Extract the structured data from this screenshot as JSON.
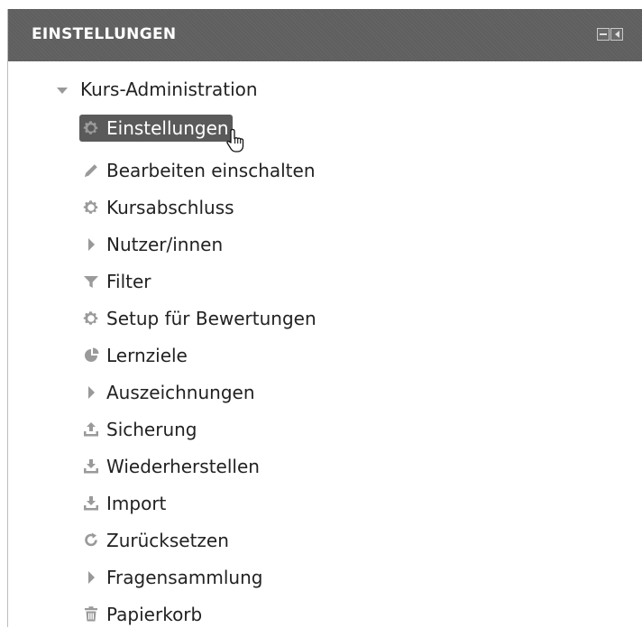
{
  "block": {
    "title": "EINSTELLUNGEN",
    "controls": {
      "collapse_icon": "collapse-icon",
      "dock_icon": "dock-icon"
    }
  },
  "tree": {
    "root_label": "Kurs-Administration",
    "items": [
      {
        "label": "Einstellungen",
        "icon": "gear-icon",
        "active": true
      },
      {
        "label": "Bearbeiten einschalten",
        "icon": "pencil-icon"
      },
      {
        "label": "Kursabschluss",
        "icon": "gear-icon"
      },
      {
        "label": "Nutzer/innen",
        "icon": "caret-right-icon"
      },
      {
        "label": "Filter",
        "icon": "filter-icon"
      },
      {
        "label": "Setup für Bewertungen",
        "icon": "gear-icon"
      },
      {
        "label": "Lernziele",
        "icon": "pie-icon"
      },
      {
        "label": "Auszeichnungen",
        "icon": "caret-right-icon"
      },
      {
        "label": "Sicherung",
        "icon": "upload-icon"
      },
      {
        "label": "Wiederherstellen",
        "icon": "download-icon"
      },
      {
        "label": "Import",
        "icon": "download-icon"
      },
      {
        "label": "Zurücksetzen",
        "icon": "reset-icon"
      },
      {
        "label": "Fragensammlung",
        "icon": "caret-right-icon"
      },
      {
        "label": "Papierkorb",
        "icon": "trash-icon"
      }
    ]
  },
  "colors": {
    "header_bg": "#5f5f5f",
    "active_bg": "#5a5a5a",
    "icon_gray": "#9a9a9a",
    "text": "#222222"
  }
}
